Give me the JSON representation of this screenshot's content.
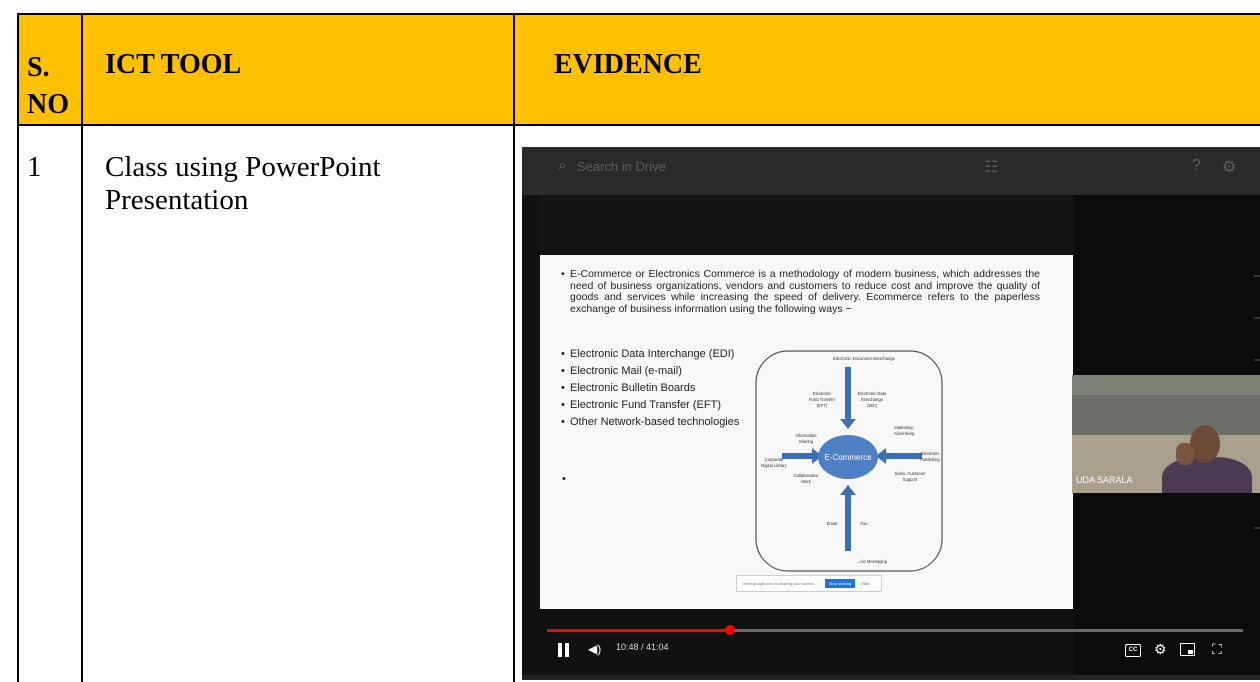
{
  "table": {
    "header": {
      "sno": "S. NO",
      "ict_tool": "ICT TOOL",
      "evidence": "EVIDENCE"
    },
    "rows": [
      {
        "sno": "1",
        "tool": "Class using PowerPoint Presentation"
      }
    ],
    "header_color": "#ffc000"
  },
  "video": {
    "search_placeholder": "Search in Drive",
    "slide": {
      "paragraph": "E-Commerce or Electronics Commerce is a methodology of modern business, which addresses the need of business organizations, vendors and customers to reduce cost and improve the quality of goods and services while increasing the speed of delivery. Ecommerce refers to the paperless exchange of business information using the following ways −",
      "bullets": [
        "Electronic Data Interchange (EDI)",
        "Electronic Mail (e-mail)",
        "Electronic Bulletin Boards",
        "Electronic Fund Transfer (EFT)",
        "Other Network-based technologies"
      ],
      "diagram": {
        "center": "E-Commerce",
        "top_label": "Electronic Document Interchange",
        "eft_label": [
          "Electronic",
          "Fund Transfer",
          "(EFT)"
        ],
        "edi_label": [
          "Electronic Data",
          "Interchange",
          "(EDI)"
        ],
        "info_label": [
          "Information",
          "Sharing"
        ],
        "library_label": [
          "Corporate",
          "Digital Library"
        ],
        "collab_label": [
          "Collaborative",
          "Work"
        ],
        "marketing_label": [
          "Marketing,",
          "Advertising"
        ],
        "publishing_label": [
          "Electronic",
          "Publishing"
        ],
        "sales_label": [
          "Sales, Customer",
          "Support"
        ],
        "email_label": "Email",
        "fax_label": "Fax",
        "messaging_label": "...nic Messaging"
      },
      "popup": {
        "text": "meet.google.com is sharing your screen.",
        "button": "Stop sharing",
        "hide": "Hide"
      }
    },
    "participant_name": "UDA SARALA",
    "time": "10:48 / 41:04",
    "progress": 0.263,
    "accent": "#ff0000"
  }
}
